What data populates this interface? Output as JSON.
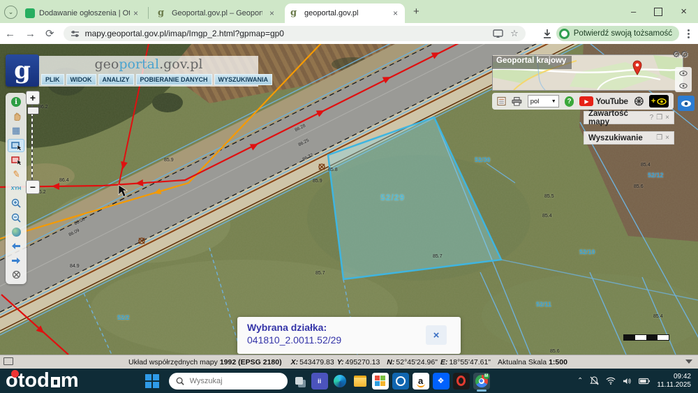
{
  "browser": {
    "tabs": [
      {
        "title": "Dodawanie ogłoszenia | Otodo"
      },
      {
        "title": "Geoportal.gov.pl – Geoportal In"
      },
      {
        "title": "geoportal.gov.pl"
      }
    ],
    "new_tab": "+",
    "url": "mapy.geoportal.gov.pl/imap/Imgp_2.html?gpmap=gp0",
    "verify_identity": "Potwierdź swoją tożsamość"
  },
  "geoportal": {
    "brand_geo": "geo",
    "brand_portal": "portal",
    "brand_suffix": ".gov.pl",
    "logo_letter": "g",
    "menu": [
      {
        "label": "PLIK"
      },
      {
        "label": "WIDOK"
      },
      {
        "label": "ANALIZY"
      },
      {
        "label": "POBIERANIE DANYCH"
      },
      {
        "label": "WYSZUKIWANIA"
      }
    ]
  },
  "left_toolbar": {
    "xyh": "XYH",
    "info": "i"
  },
  "panels": {
    "overview_title": "Geoportal krajowy",
    "lang": "pol",
    "youtube": "YouTube",
    "map_contents": "Zawartość mapy",
    "search_panel": "Wyszukiwanie"
  },
  "popup": {
    "title": "Wybrana działka:",
    "value": "041810_2.0011.52/29"
  },
  "statusbar": {
    "crs_label": "Układ współrzędnych mapy",
    "crs_value": "1992 (EPSG 2180)",
    "x_label": "X:",
    "x_value": "543479.83",
    "y_label": "Y:",
    "y_value": "495270.13",
    "n_label": "N:",
    "n_value": "52°45'24.96\"",
    "e_label": "E:",
    "e_value": "18°55'47.61\"",
    "scale_label": "Aktualna Skala",
    "scale_value": "1:500"
  },
  "taskbar": {
    "brand_left": "otod",
    "brand_right": "m",
    "search_placeholder": "Wyszukaj",
    "time": "09:42",
    "date": "11.11.2025"
  },
  "colors": {
    "tab_bar": "#cfe7c8",
    "taskbar": "#0f2c37",
    "parcel_highlight": "#3fb5e0",
    "utility_red": "#e01010",
    "utility_orange": "#f59a00",
    "cadastral_blue": "#6fb0d8"
  },
  "map": {
    "labels": [
      {
        "t": "52/29"
      },
      {
        "t": "52/30"
      },
      {
        "t": "52/12"
      },
      {
        "t": "52/10"
      },
      {
        "t": "52/11"
      },
      {
        "t": "52/2"
      },
      {
        "t": "86.2"
      },
      {
        "t": "86.2"
      },
      {
        "t": "86.4"
      },
      {
        "t": "85.9"
      },
      {
        "t": "85.9"
      },
      {
        "t": "85.8"
      },
      {
        "t": "85.7"
      },
      {
        "t": "85.7"
      },
      {
        "t": "85.5"
      },
      {
        "t": "85.4"
      },
      {
        "t": "85.4"
      },
      {
        "t": "85.6"
      },
      {
        "t": "85.4"
      },
      {
        "t": "85.6"
      },
      {
        "t": "84.9"
      },
      {
        "t": "86.08"
      },
      {
        "t": "86.09"
      },
      {
        "t": "86.28"
      },
      {
        "t": "86.25"
      },
      {
        "t": "86.32"
      }
    ]
  }
}
